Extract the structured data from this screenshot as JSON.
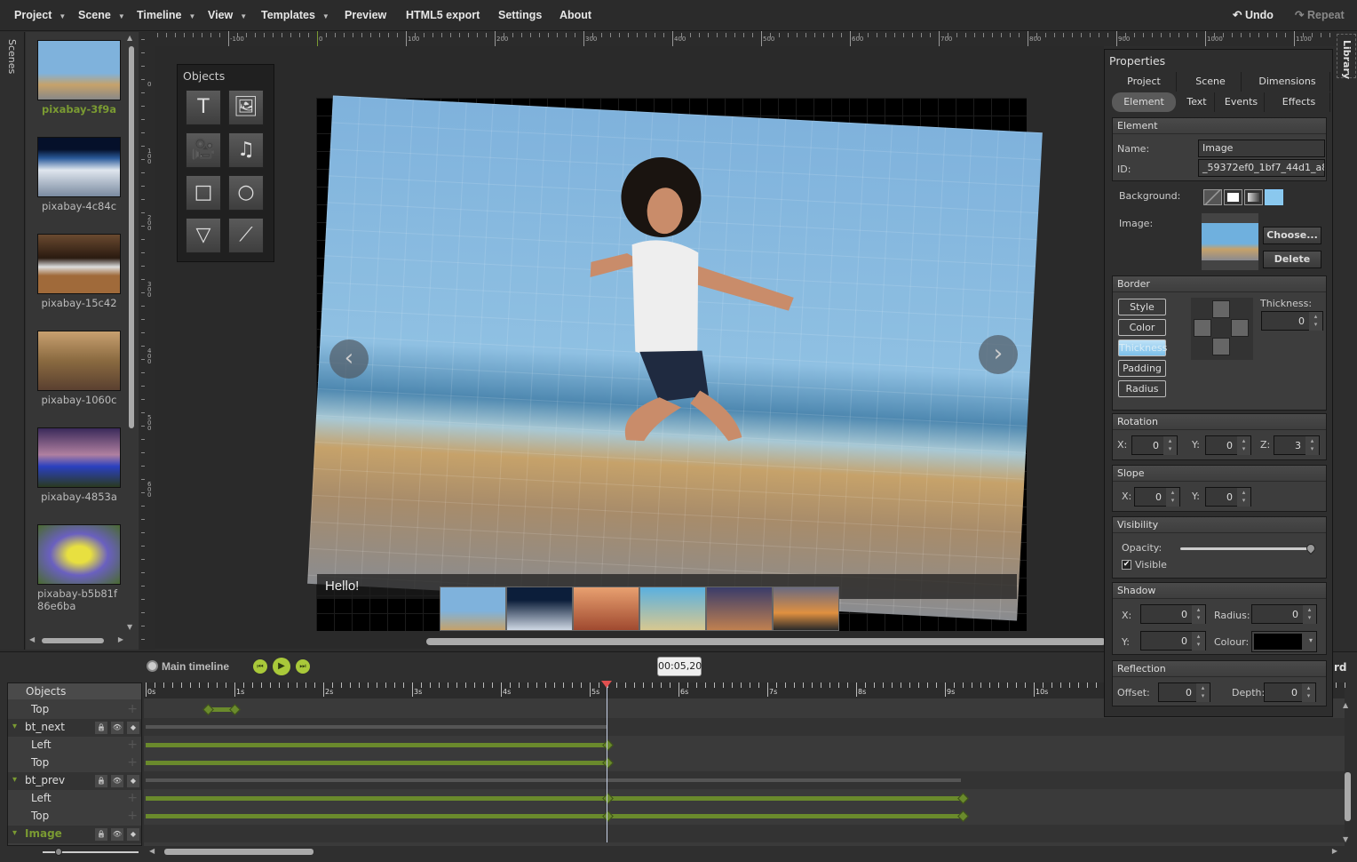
{
  "menu": {
    "items": [
      {
        "label": "Project",
        "dropdown": true
      },
      {
        "label": "Scene",
        "dropdown": true
      },
      {
        "label": "Timeline",
        "dropdown": true
      },
      {
        "label": "View",
        "dropdown": true
      },
      {
        "label": "Templates",
        "dropdown": true
      },
      {
        "label": "Preview"
      },
      {
        "label": "HTML5 export"
      },
      {
        "label": "Settings"
      },
      {
        "label": "About"
      }
    ],
    "undo": "Undo",
    "repeat": "Repeat"
  },
  "scenes": {
    "tab_label": "Scenes",
    "items": [
      {
        "label": "pixabay-3f9a",
        "selected": true
      },
      {
        "label": "pixabay-4c84c"
      },
      {
        "label": "pixabay-15c42"
      },
      {
        "label": "pixabay-1060c"
      },
      {
        "label": "pixabay-4853a"
      },
      {
        "label": "pixabay-b5b81f86e6ba"
      }
    ]
  },
  "ruler": {
    "h_labels": [
      "-100",
      "0",
      "100",
      "200",
      "300",
      "400",
      "500",
      "600",
      "700",
      "800",
      "900",
      "1000",
      "1100"
    ],
    "v_labels": [
      "0",
      "100",
      "200",
      "300",
      "400",
      "500",
      "600"
    ]
  },
  "objects_panel": {
    "title": "Objects",
    "tools": [
      "text-tool-icon",
      "image-tool-icon",
      "video-tool-icon",
      "audio-tool-icon",
      "rectangle-tool-icon",
      "ellipse-tool-icon",
      "triangle-tool-icon",
      "line-tool-icon"
    ]
  },
  "stage": {
    "caption": "Hello!",
    "prev_glyph": "‹",
    "next_glyph": "›"
  },
  "library": {
    "tab_label": "Library"
  },
  "properties": {
    "title": "Properties",
    "tabs_row1": [
      "Project",
      "Scene",
      "Dimensions"
    ],
    "tabs_row2": [
      "Element",
      "Text",
      "Events",
      "Effects"
    ],
    "active_tab": "Element",
    "element": {
      "header": "Element",
      "name_label": "Name:",
      "name_value": "Image",
      "id_label": "ID:",
      "id_value": "_59372ef0_1bf7_44d1_a80a",
      "background_label": "Background:",
      "image_label": "Image:",
      "choose": "Choose...",
      "delete": "Delete"
    },
    "border": {
      "header": "Border",
      "buttons": [
        "Style",
        "Color",
        "Thickness",
        "Padding",
        "Radius"
      ],
      "active": "Thickness",
      "thickness_label": "Thickness:",
      "thickness_value": "0"
    },
    "rotation": {
      "header": "Rotation",
      "x_label": "X:",
      "x": "0",
      "y_label": "Y:",
      "y": "0",
      "z_label": "Z:",
      "z": "3"
    },
    "slope": {
      "header": "Slope",
      "x_label": "X:",
      "x": "0",
      "y_label": "Y:",
      "y": "0"
    },
    "visibility": {
      "header": "Visibility",
      "opacity_label": "Opacity:",
      "opacity": 1.0,
      "visible_label": "Visible",
      "visible": true
    },
    "shadow": {
      "header": "Shadow",
      "x_label": "X:",
      "x": "0",
      "y_label": "Y:",
      "y": "0",
      "radius_label": "Radius:",
      "radius": "0",
      "colour_label": "Colour:",
      "colour": "#000000"
    },
    "reflection": {
      "header": "Reflection",
      "offset_label": "Offset:",
      "offset": "0",
      "depth_label": "Depth:",
      "depth": "0"
    }
  },
  "timeline": {
    "title": "Main timeline",
    "timecode": "00:05,20",
    "objects_header": "Objects",
    "tick_labels": [
      "0s",
      "1s",
      "2s",
      "3s",
      "4s",
      "5s",
      "6s",
      "7s",
      "8s",
      "9s",
      "10s"
    ],
    "playhead_s": 5.2,
    "right_fragment": "rd",
    "rows": [
      {
        "label": "Top",
        "type": "prop"
      },
      {
        "label": "bt_next",
        "type": "group"
      },
      {
        "label": "Left",
        "type": "prop"
      },
      {
        "label": "Top",
        "type": "prop"
      },
      {
        "label": "bt_prev",
        "type": "group"
      },
      {
        "label": "Left",
        "type": "prop"
      },
      {
        "label": "Top",
        "type": "prop"
      },
      {
        "label": "Image",
        "type": "group",
        "selected": true
      }
    ],
    "accent": "#6a8a2c"
  }
}
